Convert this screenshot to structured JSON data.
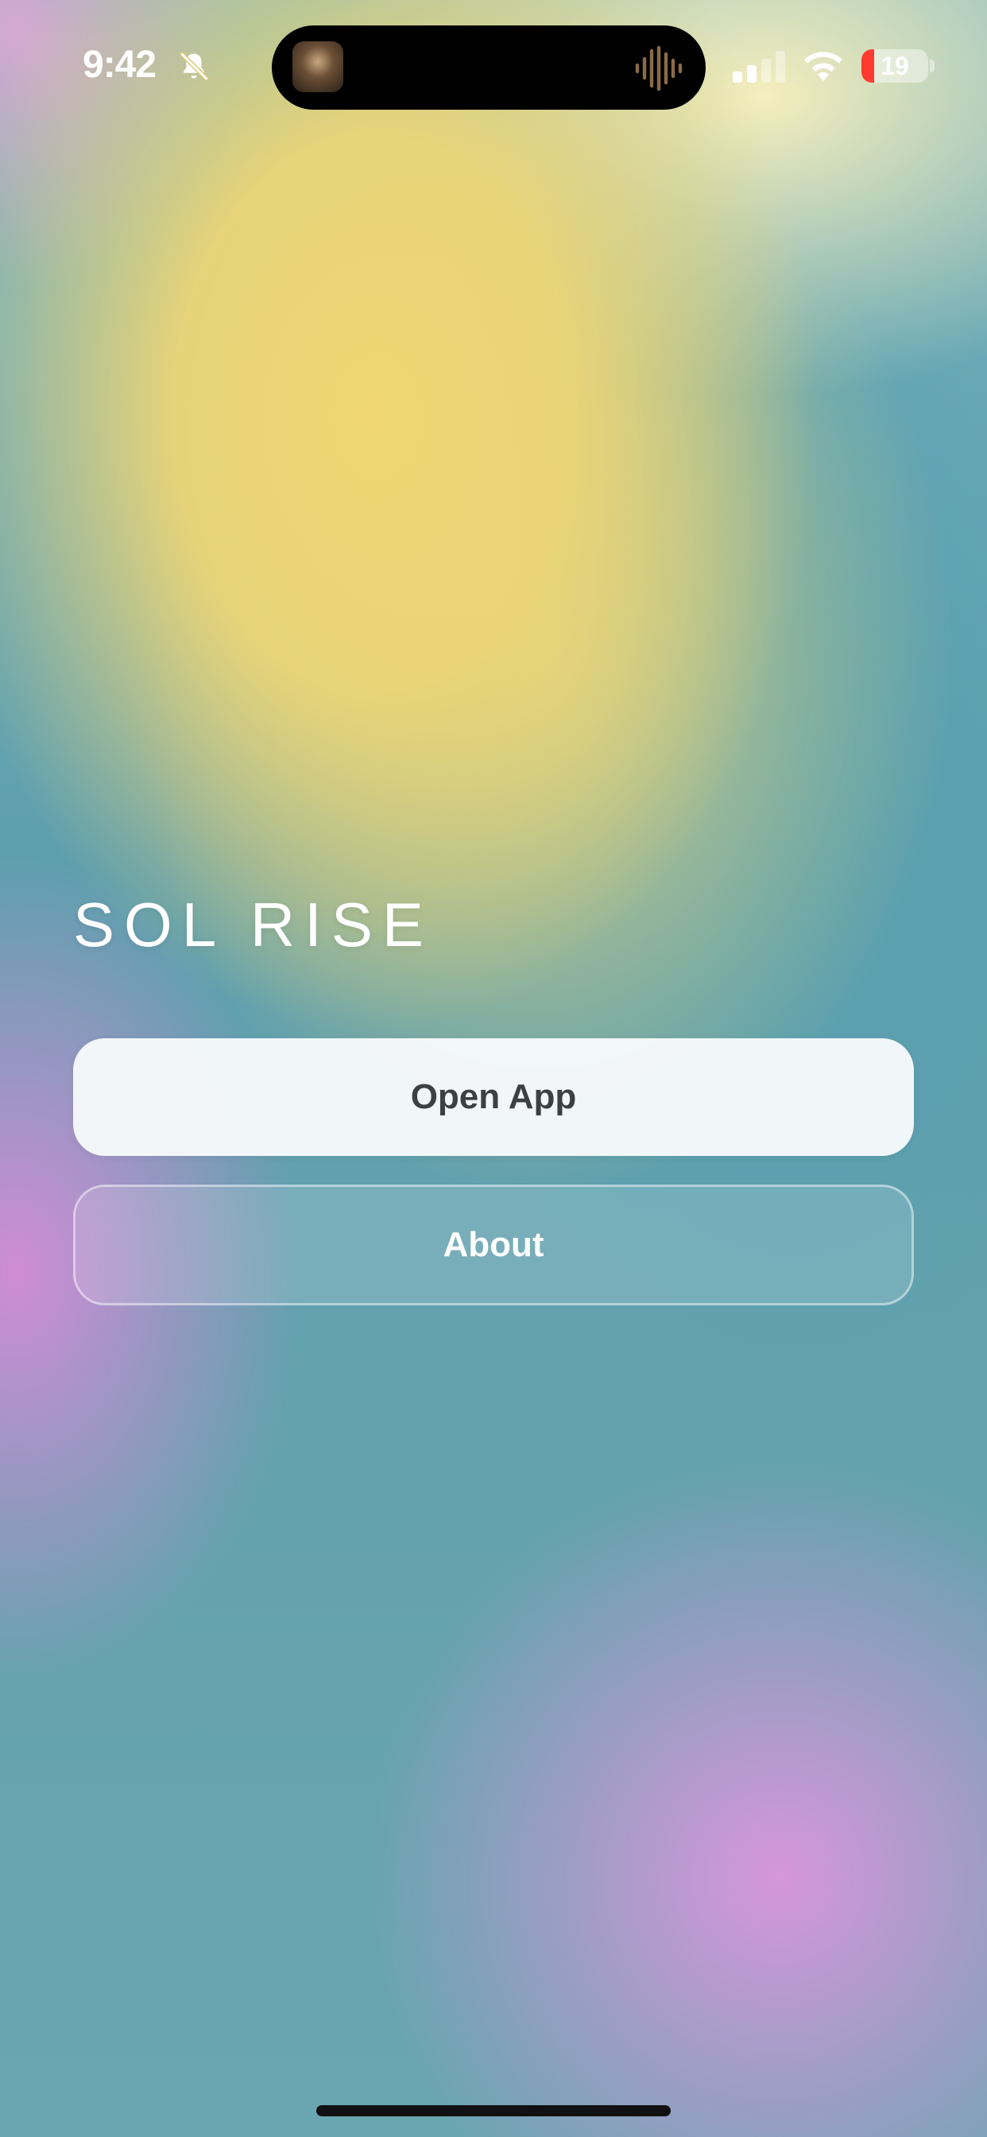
{
  "status_bar": {
    "time": "9:42",
    "battery_level": "19",
    "battery_fraction": 0.19,
    "signal_bars_active": 2,
    "icons": {
      "silent": "bell-slash-icon",
      "signal": "cellular-signal-icon",
      "wifi": "wifi-icon",
      "battery": "battery-icon"
    },
    "colors": {
      "battery_low": "#ff3b30"
    }
  },
  "dynamic_island": {
    "album_art": "album-art-thumbnail",
    "activity_icon": "audio-waveform-icon",
    "waveform_color": "#8a6a48"
  },
  "main": {
    "title": "SOL RISE",
    "primary_button": {
      "label": "Open App"
    },
    "secondary_button": {
      "label": "About"
    }
  },
  "theme": {
    "yellow": "#efd774",
    "teal": "#5fa0ad",
    "pink": "#d497d9"
  }
}
